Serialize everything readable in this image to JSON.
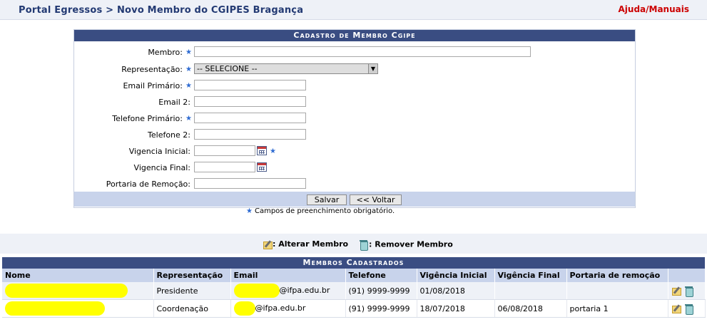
{
  "header": {
    "breadcrumb": "Portal Egressos > Novo Membro do CGIPES Bragança",
    "help_link": "Ajuda/Manuais"
  },
  "form": {
    "title": "Cadastro de Membro Cgipe",
    "fields": {
      "membro": {
        "label": "Membro:",
        "value": ""
      },
      "representacao": {
        "label": "Representação:",
        "selected": "-- SELECIONE --"
      },
      "email_primario": {
        "label": "Email Primário:",
        "value": ""
      },
      "email2": {
        "label": "Email 2:",
        "value": ""
      },
      "telefone_primario": {
        "label": "Telefone Primário:",
        "value": ""
      },
      "telefone2": {
        "label": "Telefone 2:",
        "value": ""
      },
      "vigencia_inicial": {
        "label": "Vigencia Inicial:",
        "value": ""
      },
      "vigencia_final": {
        "label": "Vigencia Final:",
        "value": ""
      },
      "portaria_remocao": {
        "label": "Portaria de Remoção:",
        "value": ""
      }
    },
    "save_label": "Salvar",
    "back_label": "<< Voltar",
    "required_note": "Campos de preenchimento obrigatório.",
    "required_symbol": "★"
  },
  "legend": {
    "edit_label": ": Alterar Membro",
    "remove_label": ": Remover Membro"
  },
  "table": {
    "title": "Membros Cadastrados",
    "columns": [
      "Nome",
      "Representação",
      "Email",
      "Telefone",
      "Vigência Inicial",
      "Vigência Final",
      "Portaria de remoção",
      ""
    ],
    "rows": [
      {
        "nome": "",
        "representacao": "Presidente",
        "email": "@ifpa.edu.br",
        "telefone": "(91) 9999-9999",
        "vigencia_inicial": "01/08/2018",
        "vigencia_final": "",
        "portaria": ""
      },
      {
        "nome": "",
        "representacao": "Coordenação",
        "email": "@ifpa.edu.br",
        "telefone": "(91) 9999-9999",
        "vigencia_inicial": "18/07/2018",
        "vigencia_final": "06/08/2018",
        "portaria": "portaria 1"
      }
    ]
  },
  "colors": {
    "header_blue": "#3a4d82",
    "light_blue": "#c8d3eb",
    "breadcrumb": "#233a73",
    "help_red": "#cc0000",
    "required_star": "#2e6bd2",
    "redaction": "#ffff00"
  }
}
